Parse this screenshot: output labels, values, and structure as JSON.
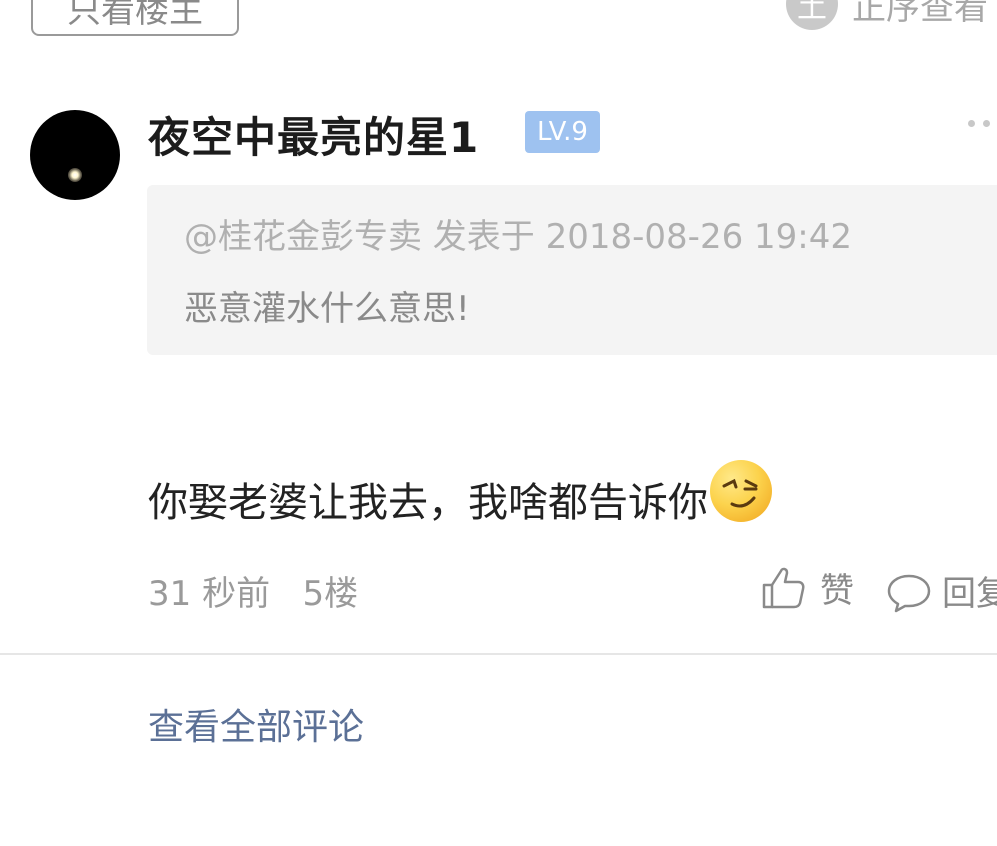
{
  "top_bar": {
    "only_op_label": "只看楼主",
    "order_icon_char": "土",
    "order_label": "正序查看"
  },
  "post": {
    "username": "夜空中最亮的星1",
    "level": "LV.9",
    "level_color": "#9ec2f0",
    "quote_header": "@桂花金彭专卖 发表于 2018-08-26 19:42",
    "quote_text": "恶意灌水什么意思!",
    "body_text": "你娶老婆让我去，我啥都告诉你",
    "emoji": "smirk-emoji",
    "time": "31 秒前",
    "floor": "5楼",
    "like_label": "赞",
    "reply_label": "回复"
  },
  "footer": {
    "view_all_label": "查看全部评论",
    "link_color": "#5b7096"
  }
}
